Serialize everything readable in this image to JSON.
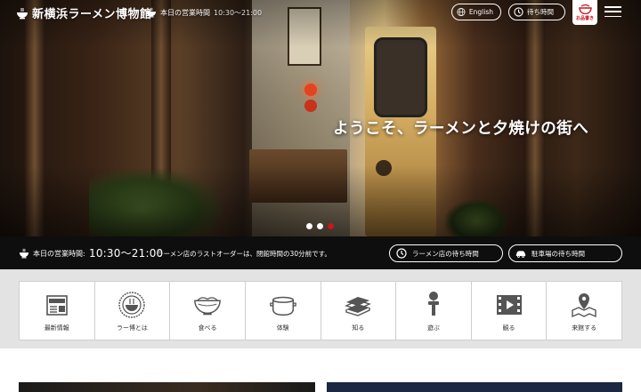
{
  "header": {
    "logo_text": "新横浜ラーメン博物館",
    "hours_label": "本日の営業時間",
    "hours_value": "10:30～21:00",
    "english_label": "English",
    "wait_label": "待ち時間",
    "okaki_label": "お品書き"
  },
  "hero": {
    "headline": "ようこそ、ラーメンと夕焼けの街へ",
    "slides": 3,
    "active_slide": 3
  },
  "infobar": {
    "hours_label": "本日の営業時間:",
    "hours_value": "10:30～21:00",
    "note": "ラーメン店のラストオーダーは、閉館時間の30分前です。",
    "ramen_wait_label": "ラーメン店の待ち時間",
    "parking_wait_label": "駐車場の待ち時間"
  },
  "nav": {
    "items": [
      {
        "label": "最新情報",
        "icon": "news-icon"
      },
      {
        "label": "ラー博とは",
        "icon": "raumen-emblem-icon"
      },
      {
        "label": "食べる",
        "icon": "ramen-bowl-icon"
      },
      {
        "label": "体験",
        "icon": "pot-icon"
      },
      {
        "label": "知る",
        "icon": "books-icon"
      },
      {
        "label": "遊ぶ",
        "icon": "kendama-icon"
      },
      {
        "label": "観る",
        "icon": "film-icon"
      },
      {
        "label": "来館する",
        "icon": "map-pin-icon"
      }
    ]
  },
  "colors": {
    "accent_red": "#c8161d",
    "infobar_bg": "#0e0e0e",
    "nav_bg": "#ffffff"
  }
}
